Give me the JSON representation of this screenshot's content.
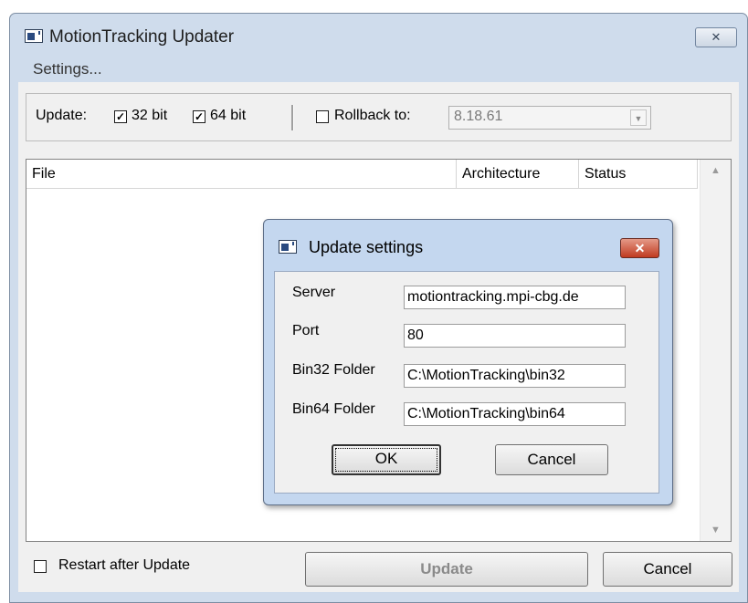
{
  "window": {
    "title": "MotionTracking Updater",
    "close_glyph": "✕",
    "icon": "app-window-icon"
  },
  "menu": {
    "settings": "Settings..."
  },
  "toolbar": {
    "update_label": "Update:",
    "bit32": {
      "label": "32 bit",
      "checked": true
    },
    "bit64": {
      "label": "64 bit",
      "checked": true
    },
    "rollback": {
      "label": "Rollback to:",
      "checked": false,
      "value": "8.18.61"
    }
  },
  "list": {
    "columns": [
      "File",
      "Architecture",
      "Status"
    ],
    "rows": []
  },
  "footer": {
    "restart_label": "Restart after Update",
    "restart_checked": false,
    "update_button": "Update",
    "cancel_button": "Cancel"
  },
  "dialog": {
    "title": "Update settings",
    "close_glyph": "✕",
    "fields": [
      {
        "label": "Server",
        "value": "motiontracking.mpi-cbg.de"
      },
      {
        "label": "Port",
        "value": "80"
      },
      {
        "label": "Bin32 Folder",
        "value": "C:\\MotionTracking\\bin32"
      },
      {
        "label": "Bin64 Folder",
        "value": "C:\\MotionTracking\\bin64"
      }
    ],
    "ok_button": "OK",
    "cancel_button": "Cancel"
  },
  "colors": {
    "title_bar": "#cfdcec",
    "dialog_frame": "#c4d7ef",
    "dialog_close": "#c03a20"
  }
}
